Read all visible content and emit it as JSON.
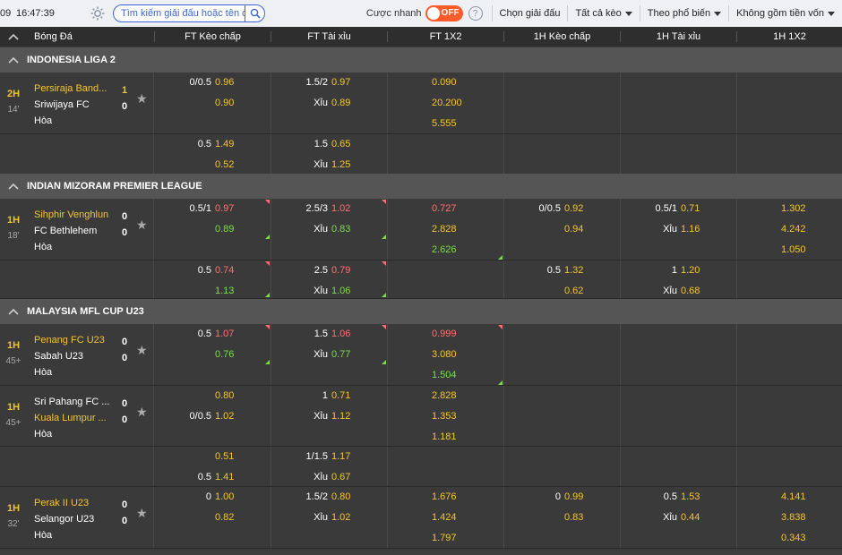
{
  "header": {
    "clock_prefix": "09",
    "clock": "16:47:39",
    "search_placeholder": "Tìm kiếm giải đấu hoặc tên đội",
    "quick_bet_label": "Cược nhanh",
    "toggle_state": "OFF",
    "help": "?",
    "select_league": "Chọn giải đấu",
    "all_markets": "Tất cả kèo",
    "popular": "Theo phổ biến",
    "capital": "Không gồm tiền vốn"
  },
  "columns": [
    "Bóng Đá",
    "FT Kèo chấp",
    "FT Tài xỉu",
    "FT 1X2",
    "1H Kèo chấp",
    "1H Tài xỉu",
    "1H 1X2"
  ],
  "leagues": [
    {
      "name": "INDONESIA LIGA 2"
    },
    {
      "name": "INDIAN MIZORAM PREMIER LEAGUE"
    },
    {
      "name": "MALAYSIA MFL CUP U23"
    }
  ],
  "matches": [
    {
      "period": "2H",
      "minute": "14'",
      "home": "Persiraja Band...",
      "away": "Sriwijaya FC",
      "draw": "Hòa",
      "home_score": "1",
      "away_score": "0",
      "ft_hdp": {
        "line": "0/0.5",
        "h": "0.96",
        "a": "0.90"
      },
      "ft_ou": {
        "line": "1.5/2",
        "o": "0.97",
        "ux": "Xỉu",
        "u": "0.89"
      },
      "ft_1x2": {
        "h": "0.090",
        "a": "20.200",
        "d": "5.555"
      }
    },
    {
      "sub": true,
      "ft_hdp": {
        "line": "0.5",
        "h": "1.49",
        "a": "0.52"
      },
      "ft_ou": {
        "line": "1.5",
        "o": "0.65",
        "ux": "Xỉu",
        "u": "1.25"
      }
    },
    {
      "period": "1H",
      "minute": "18'",
      "home": "Sihphir Venghlun",
      "away": "FC Bethlehem",
      "draw": "Hòa",
      "home_score": "0",
      "away_score": "0",
      "ft_hdp": {
        "line": "0.5/1",
        "h": "0.97",
        "a": "0.89"
      },
      "ft_ou": {
        "line": "2.5/3",
        "o": "1.02",
        "ux": "Xỉu",
        "u": "0.83"
      },
      "ft_1x2": {
        "h": "0.727",
        "a": "2.828",
        "d": "2.626"
      },
      "h1_hdp": {
        "line": "0/0.5",
        "h": "0.92",
        "a": "0.94"
      },
      "h1_ou": {
        "line": "0.5/1",
        "o": "0.71",
        "ux": "Xỉu",
        "u": "1.16"
      },
      "h1_1x2": {
        "h": "1.302",
        "a": "4.242",
        "d": "1.050"
      }
    },
    {
      "sub": true,
      "ft_hdp": {
        "line": "0.5",
        "h": "0.74",
        "a": "1.13"
      },
      "ft_ou": {
        "line": "2.5",
        "o": "0.79",
        "ux": "Xỉu",
        "u": "1.06"
      },
      "h1_hdp": {
        "line": "0.5",
        "h": "1.32",
        "a": "0.62"
      },
      "h1_ou": {
        "line": "1",
        "o": "1.20",
        "ux": "Xỉu",
        "u": "0.68"
      }
    },
    {
      "period": "1H",
      "minute": "45+",
      "home": "Penang FC U23",
      "away": "Sabah U23",
      "draw": "Hòa",
      "home_score": "0",
      "away_score": "0",
      "ft_hdp": {
        "line": "0.5",
        "h": "1.07",
        "a": "0.76"
      },
      "ft_ou": {
        "line": "1.5",
        "o": "1.06",
        "ux": "Xỉu",
        "u": "0.77"
      },
      "ft_1x2": {
        "h": "0.999",
        "a": "3.080",
        "d": "1.504"
      }
    },
    {
      "period": "1H",
      "minute": "45+",
      "home": "Sri Pahang FC ...",
      "away": "Kuala Lumpur ...",
      "draw": "Hòa",
      "home_score": "0",
      "away_score": "0",
      "ft_hdp": {
        "line": "",
        "h": "0.80",
        "line2": "0/0.5",
        "a": "1.02"
      },
      "ft_ou": {
        "line": "1",
        "o": "0.71",
        "ux": "Xỉu",
        "u": "1.12"
      },
      "ft_1x2": {
        "h": "2.828",
        "a": "1.353",
        "d": "1.181"
      }
    },
    {
      "sub": true,
      "ft_hdp": {
        "line": "",
        "h": "0.51",
        "line2": "0.5",
        "a": "1.41"
      },
      "ft_ou": {
        "line": "1/1.5",
        "o": "1.17",
        "ux": "Xỉu",
        "u": "0.67"
      }
    },
    {
      "period": "1H",
      "minute": "32'",
      "home": "Perak II U23",
      "away": "Selangor U23",
      "draw": "Hòa",
      "home_score": "0",
      "away_score": "0",
      "ft_hdp": {
        "line": "0",
        "h": "1.00",
        "a": "0.82"
      },
      "ft_ou": {
        "line": "1.5/2",
        "o": "0.80",
        "ux": "Xỉu",
        "u": "1.02"
      },
      "ft_1x2": {
        "h": "1.676",
        "a": "1.424",
        "d": "1.797"
      },
      "h1_hdp": {
        "line": "0",
        "h": "0.99",
        "a": "0.83"
      },
      "h1_ou": {
        "line": "0.5",
        "o": "1.53",
        "ux": "Xỉu",
        "u": "0.44"
      },
      "h1_1x2": {
        "h": "4.141",
        "a": "3.838",
        "d": "0.343"
      }
    }
  ],
  "colors": {
    "odds": "#f4c430",
    "odds_down": "#ff6f6f",
    "odds_up": "#7ddc4a",
    "toggle": "#ff5a2a",
    "accent": "#3b67d6"
  }
}
